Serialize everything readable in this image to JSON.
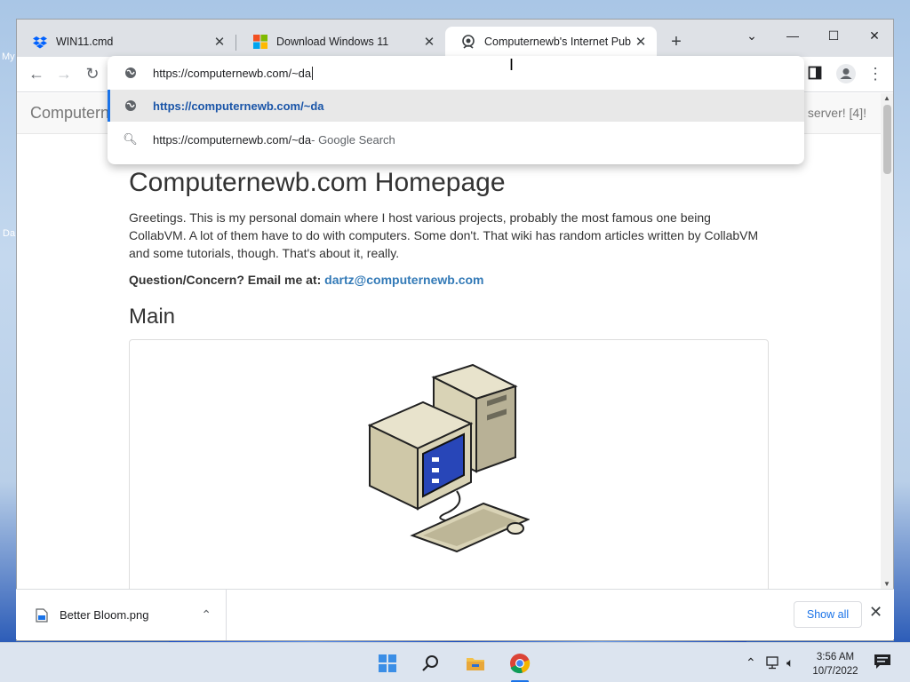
{
  "desktop": {
    "icon1_label": "My",
    "icon2_label": "Da"
  },
  "tabs": [
    {
      "title": "WIN11.cmd",
      "icon": "dropbox-icon",
      "active": false
    },
    {
      "title": "Download Windows 11",
      "icon": "windows-logo-icon",
      "active": false
    },
    {
      "title": "Computernewb's Internet Pub H",
      "icon": "site-favicon",
      "active": true
    }
  ],
  "window_controls": {
    "tab_search": "⌄",
    "minimize": "—",
    "maximize": "☐",
    "close": "✕"
  },
  "omnibox": {
    "typed_text": "https://computernewb.com/~da",
    "suggestions": [
      {
        "icon": "globe-icon",
        "text": "https://computernewb.com/~da",
        "suffix": ""
      },
      {
        "icon": "search-icon",
        "text": "https://computernewb.com/~da",
        "suffix": " - Google Search"
      }
    ]
  },
  "page": {
    "brand": "Computern",
    "nav_right": "server! [4]!",
    "title": "Computernewb.com Homepage",
    "intro": "Greetings. This is my personal domain where I host various projects, probably the most famous one being CollabVM. A lot of them have to do with computers. Some don't. That wiki has random articles written by CollabVM and some tutorials, though. That's about it, really.",
    "contact_label": "Question/Concern? Email me at:",
    "contact_email": "dartz@computernewb.com",
    "section_heading": "Main"
  },
  "downloads": {
    "file_name": "Better Bloom.png",
    "show_all": "Show all"
  },
  "taskbar": {
    "time": "3:56 AM",
    "date": "10/7/2022"
  },
  "colors": {
    "accent": "#1a73e8",
    "link": "#337ab7",
    "tabstrip": "#dee1e6"
  }
}
